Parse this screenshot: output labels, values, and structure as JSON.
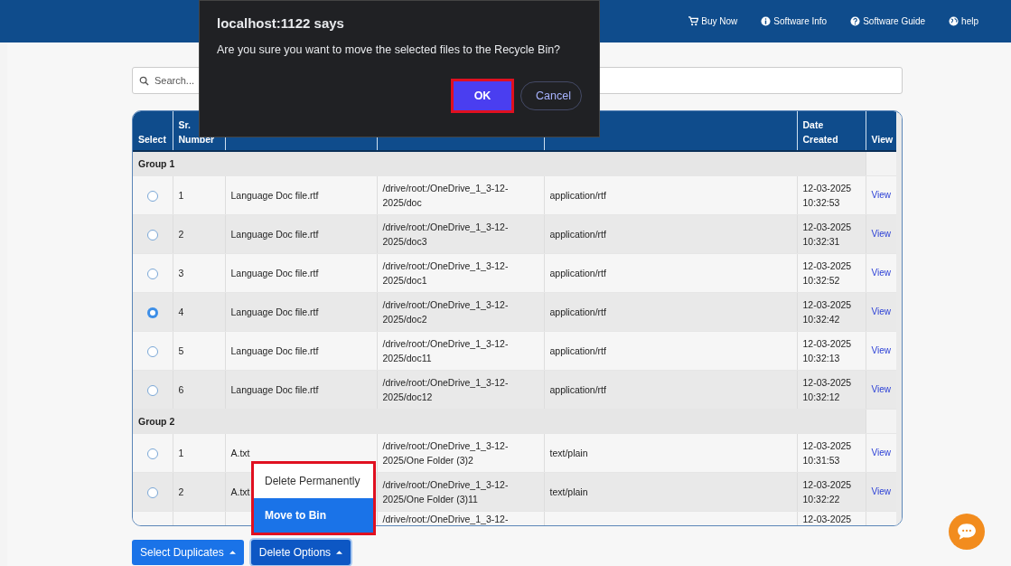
{
  "nav": [
    {
      "label": "Buy Now"
    },
    {
      "label": "Software Info"
    },
    {
      "label": "Software Guide"
    },
    {
      "label": "help"
    }
  ],
  "search": {
    "placeholder": "Search..."
  },
  "table": {
    "columns": [
      "Select",
      "Sr. Number",
      "Date Created",
      "View"
    ],
    "groups": [
      {
        "title": "Group 1",
        "rows": [
          {
            "selected": false,
            "sr": "1",
            "name": "Language Doc file.rtf",
            "path": [
              "/drive/root:/OneDrive_1_3-12-",
              "2025/doc"
            ],
            "type": "application/rtf",
            "date": [
              "12-03-2025",
              "10:32:53"
            ],
            "view": "View"
          },
          {
            "selected": false,
            "sr": "2",
            "name": "Language Doc file.rtf",
            "path": [
              "/drive/root:/OneDrive_1_3-12-",
              "2025/doc3"
            ],
            "type": "application/rtf",
            "date": [
              "12-03-2025",
              "10:32:31"
            ],
            "view": "View"
          },
          {
            "selected": false,
            "sr": "3",
            "name": "Language Doc file.rtf",
            "path": [
              "/drive/root:/OneDrive_1_3-12-",
              "2025/doc1"
            ],
            "type": "application/rtf",
            "date": [
              "12-03-2025",
              "10:32:52"
            ],
            "view": "View"
          },
          {
            "selected": true,
            "sr": "4",
            "name": "Language Doc file.rtf",
            "path": [
              "/drive/root:/OneDrive_1_3-12-",
              "2025/doc2"
            ],
            "type": "application/rtf",
            "date": [
              "12-03-2025",
              "10:32:42"
            ],
            "view": "View"
          },
          {
            "selected": false,
            "sr": "5",
            "name": "Language Doc file.rtf",
            "path": [
              "/drive/root:/OneDrive_1_3-12-",
              "2025/doc11"
            ],
            "type": "application/rtf",
            "date": [
              "12-03-2025",
              "10:32:13"
            ],
            "view": "View"
          },
          {
            "selected": false,
            "sr": "6",
            "name": "Language Doc file.rtf",
            "path": [
              "/drive/root:/OneDrive_1_3-12-",
              "2025/doc12"
            ],
            "type": "application/rtf",
            "date": [
              "12-03-2025",
              "10:32:12"
            ],
            "view": "View"
          }
        ]
      },
      {
        "title": "Group 2",
        "rows": [
          {
            "selected": false,
            "sr": "1",
            "name": "A.txt",
            "path": [
              "/drive/root:/OneDrive_1_3-12-",
              "2025/One Folder (3)2"
            ],
            "type": "text/plain",
            "date": [
              "12-03-2025",
              "10:31:53"
            ],
            "view": "View"
          },
          {
            "selected": false,
            "sr": "2",
            "name": "A.txt",
            "path": [
              "/drive/root:/OneDrive_1_3-12-",
              "2025/One Folder (3)11"
            ],
            "type": "text/plain",
            "date": [
              "12-03-2025",
              "10:32:22"
            ],
            "view": "View"
          },
          {
            "path": [
              "/drive/root:/OneDrive_1_3-12-"
            ],
            "date": [
              "12-03-2025"
            ]
          }
        ]
      }
    ]
  },
  "buttons": [
    {
      "label": "Select Duplicates",
      "active": false
    },
    {
      "label": "Delete Options",
      "active": true
    }
  ],
  "menu": {
    "annotated": true,
    "items": [
      {
        "label": "Delete Permanently",
        "selected": false
      },
      {
        "label": "Move to Bin",
        "selected": true
      }
    ]
  },
  "dialog": {
    "title": "localhost:1122 says",
    "message": "Are you sure you want to move the selected files to the Recycle Bin?",
    "buttons": [
      {
        "label": "OK",
        "kind": "primary",
        "annotated": true
      },
      {
        "label": "Cancel",
        "kind": "secondary",
        "annotated": false
      }
    ]
  }
}
